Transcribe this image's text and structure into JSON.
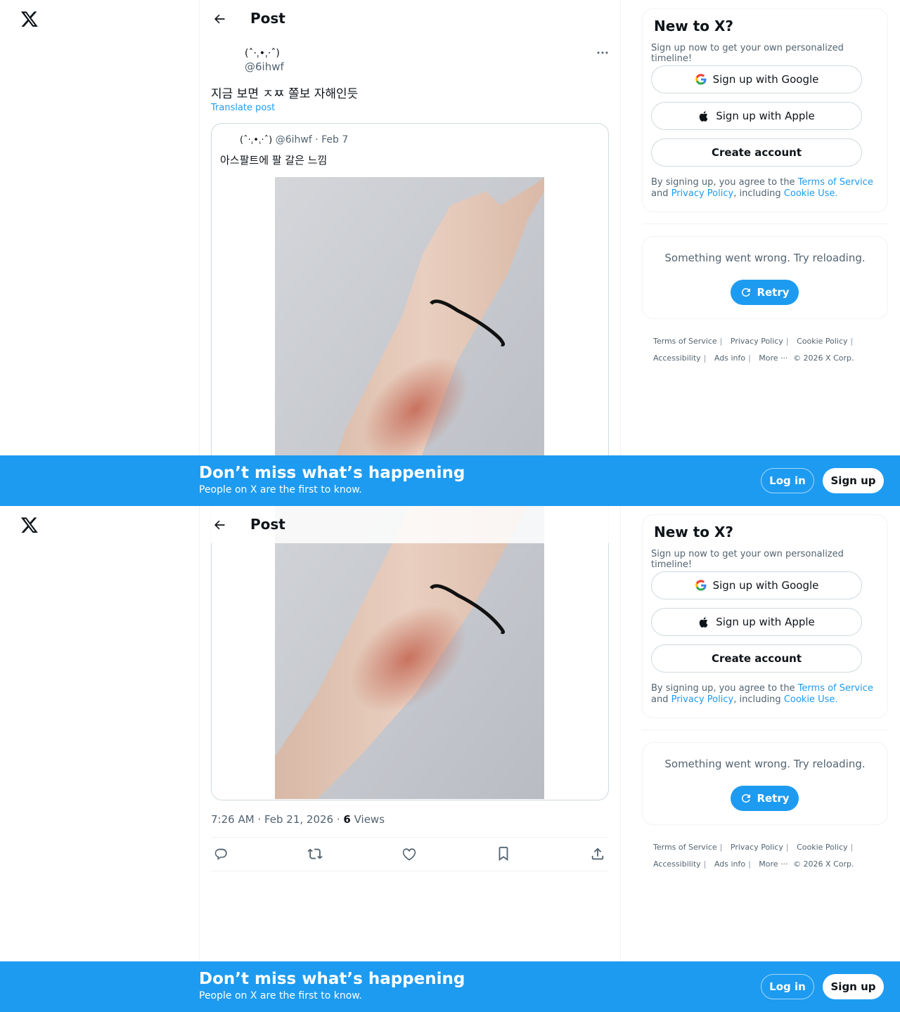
{
  "brand": {
    "accent": "#1d9bf0",
    "text": "#0f1419",
    "muted": "#536471"
  },
  "header": {
    "title": "Post"
  },
  "post": {
    "author_name": "(ˆ·ˌ•ˌ·ˆ)",
    "handle": "@6ihwf",
    "text": "지금 보면 ㅈㅉ 쫄보 자해인듯",
    "translate": "Translate post",
    "timestamp": "7:26 AM · Feb 21, 2026 · ",
    "views_count": "6",
    "views_label": " Views"
  },
  "quote": {
    "author_name": "(ˆ·ˌ•ˌ·ˆ)",
    "handle_date": "@6ihwf · Feb 7",
    "text": "아스팔트에 팔 갈은 느낌"
  },
  "actions": [
    "reply-icon",
    "repost-icon",
    "like-icon",
    "bookmark-icon",
    "share-icon"
  ],
  "signup": {
    "title": "New to X?",
    "subtitle": "Sign up now to get your own personalized timeline!",
    "google": "Sign up with Google",
    "apple": "Sign up with Apple",
    "create": "Create account",
    "terms_1": "By signing up, you agree to the ",
    "terms_link": "Terms of Service",
    "terms_2": " and ",
    "privacy_link": "Privacy Policy",
    "terms_3": ", including ",
    "cookie_link": "Cookie Use."
  },
  "error": {
    "message": "Something went wrong. Try reloading.",
    "retry": "Retry"
  },
  "footer": {
    "terms": "Terms of Service",
    "privacy": "Privacy Policy",
    "cookie": "Cookie Policy",
    "accessibility": "Accessibility",
    "ads": "Ads info",
    "more": "More ···",
    "copyright": "© 2026 X Corp."
  },
  "banner": {
    "title": "Don’t miss what’s happening",
    "subtitle": "People on X are the first to know.",
    "login": "Log in",
    "signup": "Sign up"
  }
}
